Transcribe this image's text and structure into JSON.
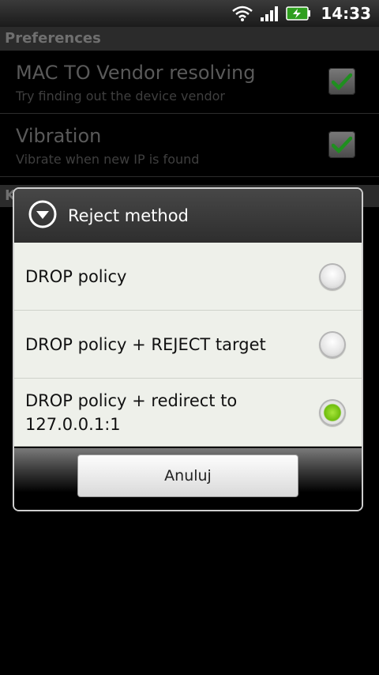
{
  "statusbar": {
    "time": "14:33",
    "icons": [
      "wifi-icon",
      "signal-icon",
      "battery-charging-icon"
    ]
  },
  "preferences": {
    "header": "Preferences",
    "items": [
      {
        "title": "MAC TO Vendor resolving",
        "subtitle": "Try finding out the device vendor",
        "checked": true
      },
      {
        "title": "Vibration",
        "subtitle": "Vibrate when new IP is found",
        "checked": true
      }
    ],
    "second_header_fragment": "K"
  },
  "dialog": {
    "title": "Reject method",
    "options": [
      {
        "label": "DROP policy",
        "selected": false
      },
      {
        "label": "DROP policy + REJECT target",
        "selected": false
      },
      {
        "label": "DROP policy + redirect to 127.0.0.1:1",
        "selected": true
      }
    ],
    "cancel_label": "Anuluj"
  },
  "colors": {
    "check_green": "#1f8f1f",
    "radio_selected": "#6fbd0e",
    "dialog_body": "#eef0ea"
  }
}
